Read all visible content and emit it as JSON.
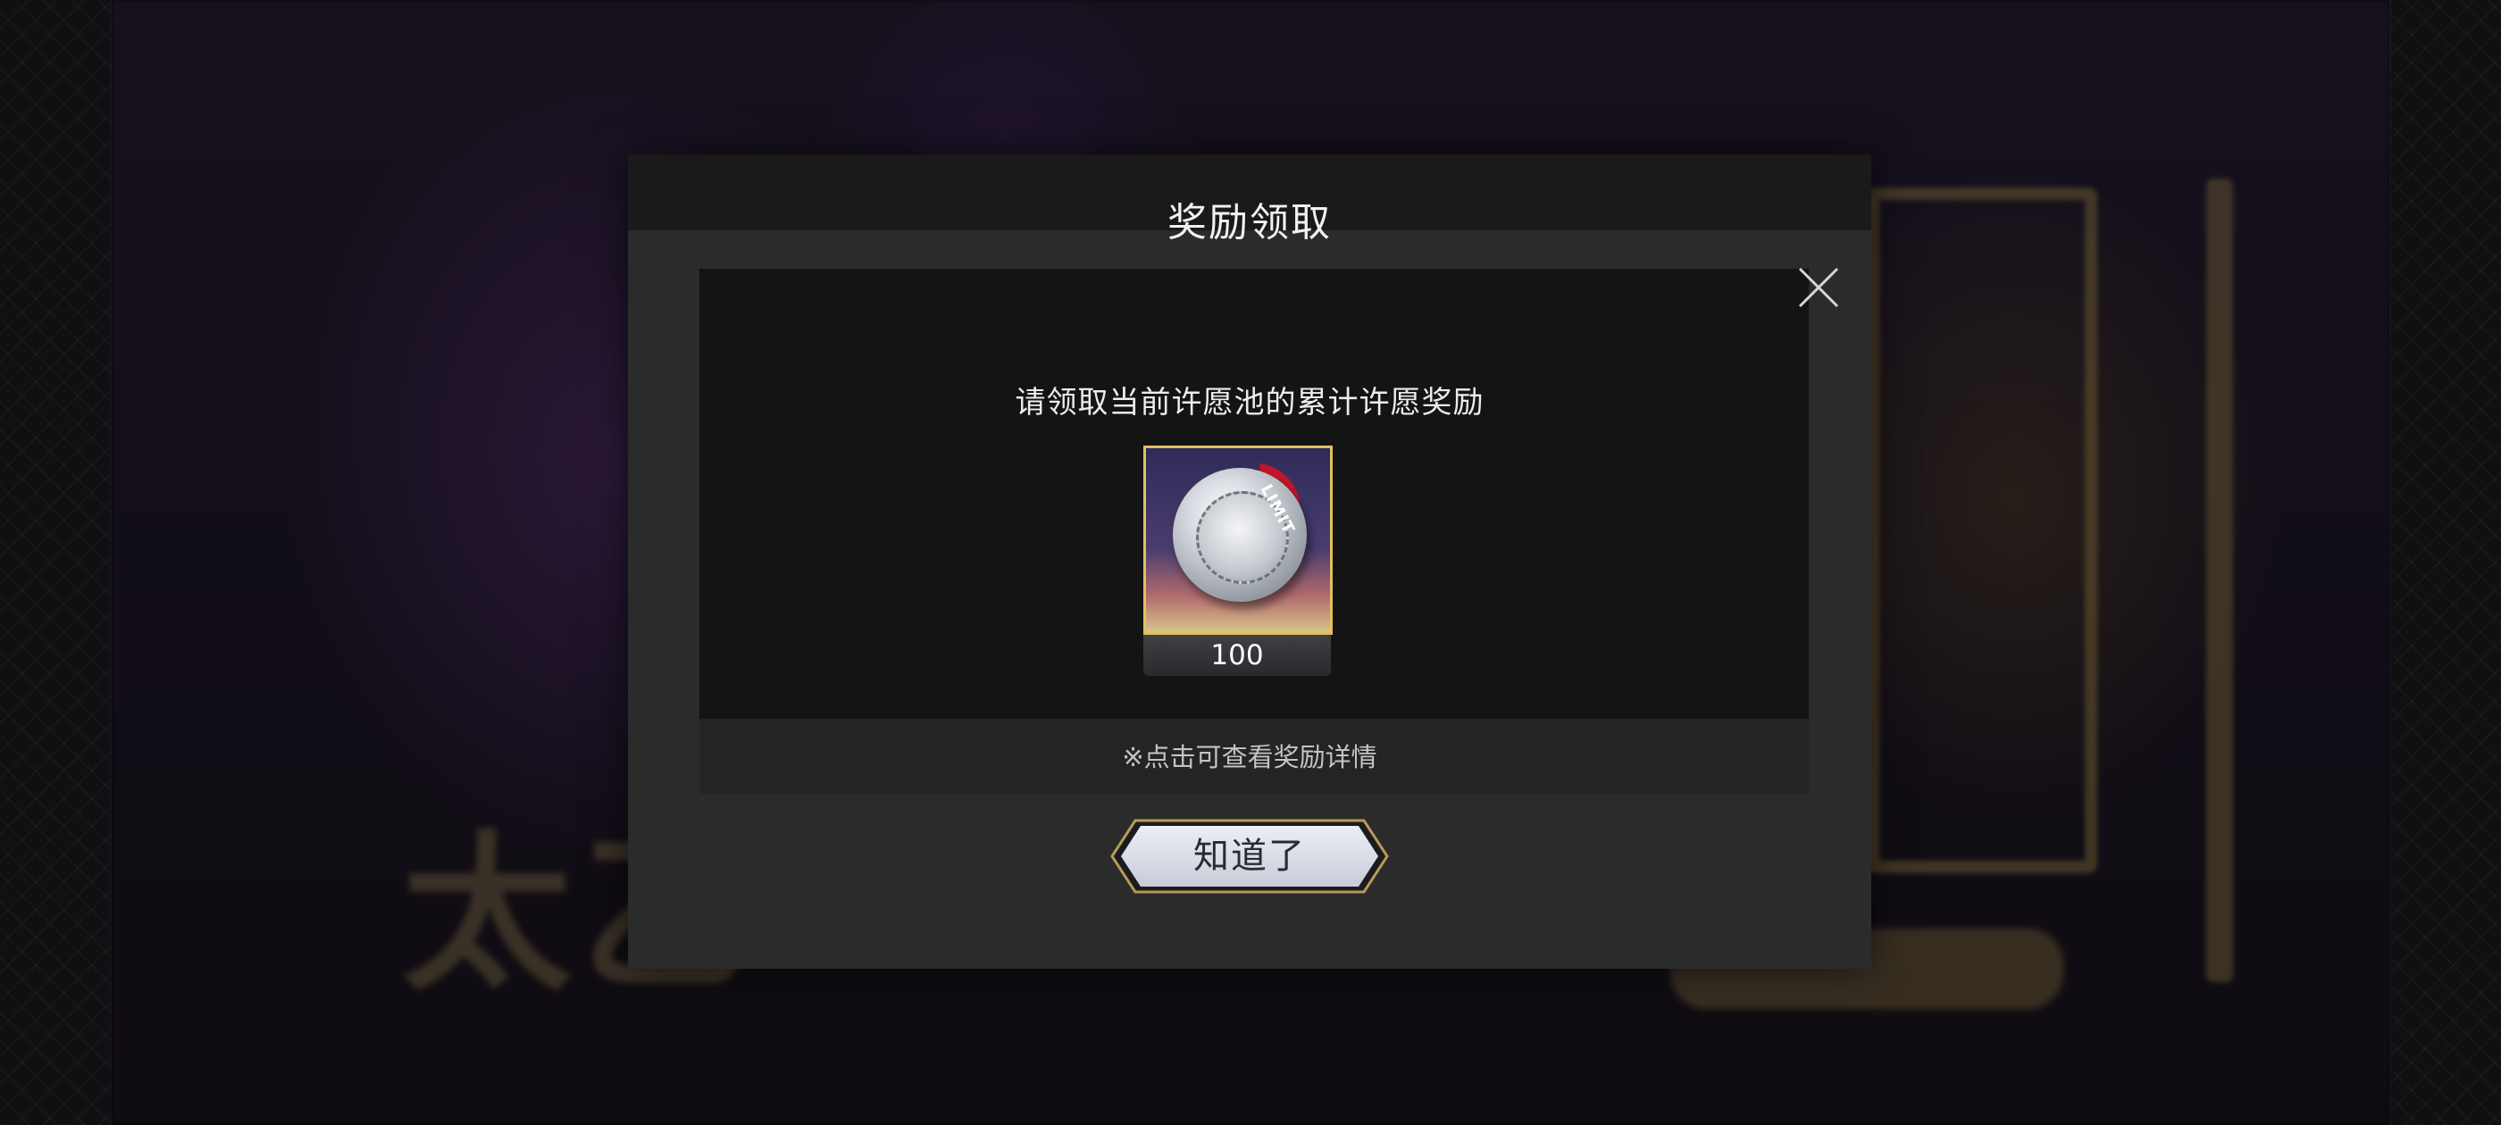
{
  "dialog": {
    "title": "奖励领取",
    "prompt": "请领取当前许愿池的累计许愿奖励",
    "hint": "※点击可查看奖励详情",
    "confirm_label": "知道了",
    "close_icon": "close-icon"
  },
  "reward": {
    "icon": "silver-limited-coin-icon",
    "tag_label": "LIMIT",
    "count": "100"
  },
  "colors": {
    "frame_gold": "#e2c15a",
    "tag_red": "#c0162b",
    "modal_bg": "#2b2b2c"
  }
}
